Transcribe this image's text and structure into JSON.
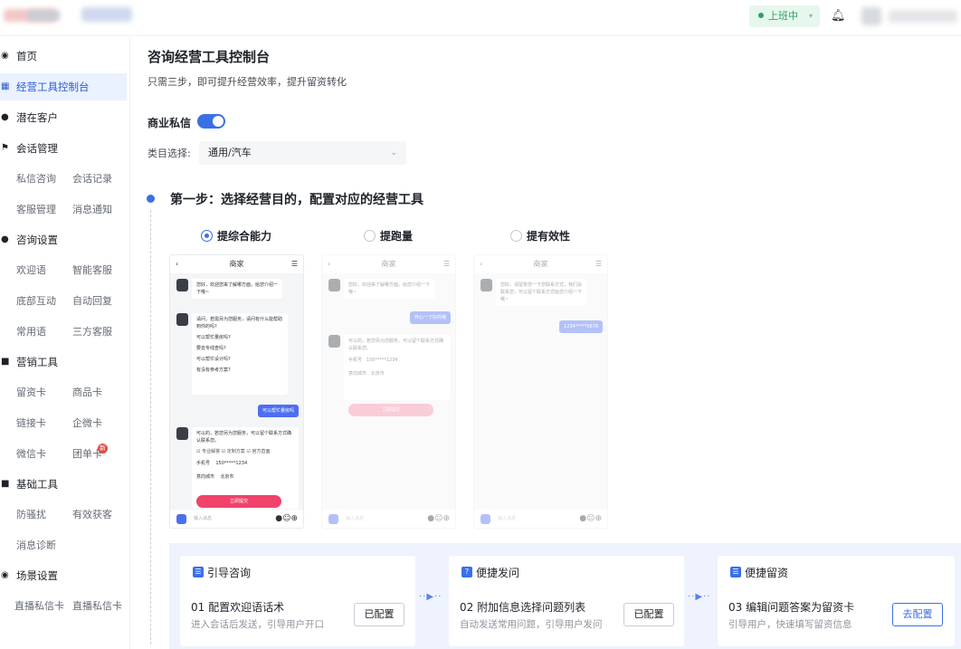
{
  "topbar": {
    "status_label": "上班中"
  },
  "sidebar": {
    "sections": [
      {
        "label": "首页",
        "icon": "home-icon"
      },
      {
        "label": "经营工具控制台",
        "icon": "dashboard-icon",
        "active": true
      },
      {
        "label": "潜在客户",
        "icon": "users-icon"
      },
      {
        "label": "会话管理",
        "icon": "flag-icon",
        "subs": [
          "私信咨询",
          "会话记录",
          "客服管理",
          "消息通知"
        ]
      },
      {
        "label": "咨询设置",
        "icon": "user-settings-icon",
        "subs": [
          "欢迎语",
          "智能客服",
          "底部互动",
          "自动回复",
          "常用语",
          "三方客服"
        ]
      },
      {
        "label": "营销工具",
        "icon": "folder-icon",
        "subs": [
          "留资卡",
          "商品卡",
          "链接卡",
          "企微卡",
          "微信卡",
          "团单卡"
        ]
      },
      {
        "label": "基础工具",
        "icon": "toolbox-icon",
        "subs": [
          "防骚扰",
          "有效获客",
          "消息诊断"
        ]
      },
      {
        "label": "场景设置",
        "icon": "scene-icon",
        "subs": [
          "直播私信卡",
          "直播私信卡"
        ]
      }
    ]
  },
  "main": {
    "title": "咨询经营工具控制台",
    "subtitle": "只需三步，即可提升经营效率，提升留资转化",
    "toggle_label": "商业私信",
    "category_label": "类目选择:",
    "category_value": "通用/汽车",
    "step1_title": "第一步：选择经营目的，配置对应的经营工具",
    "options": [
      {
        "label": "提综合能力",
        "selected": true
      },
      {
        "label": "提跑量",
        "selected": false
      },
      {
        "label": "提有效性",
        "selected": false
      }
    ]
  },
  "phone": {
    "header": "商家",
    "msg1": "您好，欢迎您来了解哪方面，给您介绍一下哦~",
    "msg2": "请问，若需另为您服务，请问有什么能帮助到你的吗?",
    "q1": "可以帮忙量房吗?",
    "q2": "要去专线查吗?",
    "q3": "可以帮忙设计吗?",
    "q4": "有没有参考方案?",
    "user_reply": "可以帮忙量房吗",
    "msg3": "可以的，若您另为您服务，可以留个联系方式确认联系您。",
    "chk1": "专业解答",
    "chk2": "定制方案",
    "chk3": "官方直面",
    "phone_label": "手机号",
    "phone_value": "150*****1234",
    "city_label": "意向城市",
    "city_value": "北京市",
    "submit": "立即提交",
    "input_placeholder": "输入消息",
    "msg_b1": "您好，欢迎来了解哪方面，给您介绍一下哦~",
    "user_reply_b": "开心一下好的哦",
    "msg_b2": "可以的，若您另为您服务，可以留个联系方式确认联系您。",
    "phone_value_b": "150*****1234",
    "city_label_b": "意向城市",
    "city_value_b": "北京市",
    "msg_c1": "您好，请留意您一下您联系方式，我们会联系您，可以留个联系方式给您介绍一下哦~",
    "user_reply_c": "1234*****5678"
  },
  "flow": {
    "cards": [
      {
        "title": "引导咨询",
        "icon": "chat-icon",
        "name": "01 配置欢迎语话术",
        "desc": "进入会话后发送，引导用户开口",
        "button": "已配置",
        "primary": false
      },
      {
        "title": "便捷发问",
        "icon": "question-icon",
        "name": "02 附加信息选择问题列表",
        "desc": "自动发送常用问题，引导用户发问",
        "button": "已配置",
        "primary": false
      },
      {
        "title": "便捷留资",
        "icon": "form-icon",
        "name": "03 编辑问题答案为留资卡",
        "desc": "引导用户，快速填写留资信息",
        "button": "去配置",
        "primary": true
      }
    ]
  },
  "colors": {
    "accent": "#3b6fe8",
    "active_bg": "#eaf1ff",
    "status_green": "#2ea262",
    "pink": "#f0436a"
  }
}
